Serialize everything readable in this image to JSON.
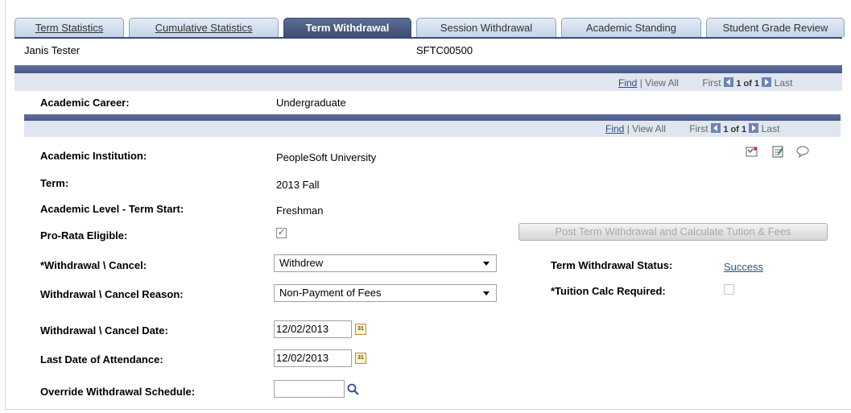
{
  "tabs": [
    {
      "label": "Term Statistics",
      "active": false
    },
    {
      "label": "Cumulative Statistics",
      "active": false
    },
    {
      "label": "Term Withdrawal",
      "active": true
    },
    {
      "label": "Session Withdrawal",
      "active": false
    },
    {
      "label": "Academic Standing",
      "active": false
    },
    {
      "label": "Student Grade Review",
      "active": false
    }
  ],
  "header": {
    "student_name": "Janis Tester",
    "student_id": "SFTC00500"
  },
  "nav": {
    "find": "Find",
    "sep": "|",
    "view_all": "View All",
    "first": "First",
    "count": "1 of 1",
    "last": "Last"
  },
  "career": {
    "label": "Academic Career:",
    "value": "Undergraduate"
  },
  "fields": {
    "institution": {
      "label": "Academic Institution:",
      "value": "PeopleSoft University"
    },
    "term": {
      "label": "Term:",
      "value": "2013 Fall"
    },
    "level": {
      "label": "Academic Level - Term Start:",
      "value": "Freshman"
    },
    "prorata": {
      "label": "Pro-Rata Eligible:",
      "checked": true
    },
    "withdrawal_cancel": {
      "label": "*Withdrawal \\ Cancel:",
      "value": "Withdrew"
    },
    "reason": {
      "label": "Withdrawal \\ Cancel Reason:",
      "value": "Non-Payment of Fees"
    },
    "date": {
      "label": "Withdrawal \\ Cancel Date:",
      "value": "12/02/2013"
    },
    "last_attendance": {
      "label": "Last Date of Attendance:",
      "value": "12/02/2013"
    },
    "override_schedule": {
      "label": "Override Withdrawal Schedule:",
      "value": ""
    },
    "status": {
      "label": "Term Withdrawal Status:",
      "value": "Success"
    },
    "tuition_calc": {
      "label": "*Tuition Calc Required:",
      "checked": false
    }
  },
  "post_button": {
    "label": "Post Term Withdrawal and Calculate Tution & Fees"
  },
  "calendar_icon_text": "31",
  "icons": [
    "map-icon",
    "notepad-icon",
    "comment-icon",
    "calendar-icon",
    "search-icon"
  ],
  "colors": {
    "tab_active": "#3c4c74",
    "tab_inactive": "#c4d3e8",
    "bar": "#4a5a88",
    "link": "#2e4c8c"
  }
}
